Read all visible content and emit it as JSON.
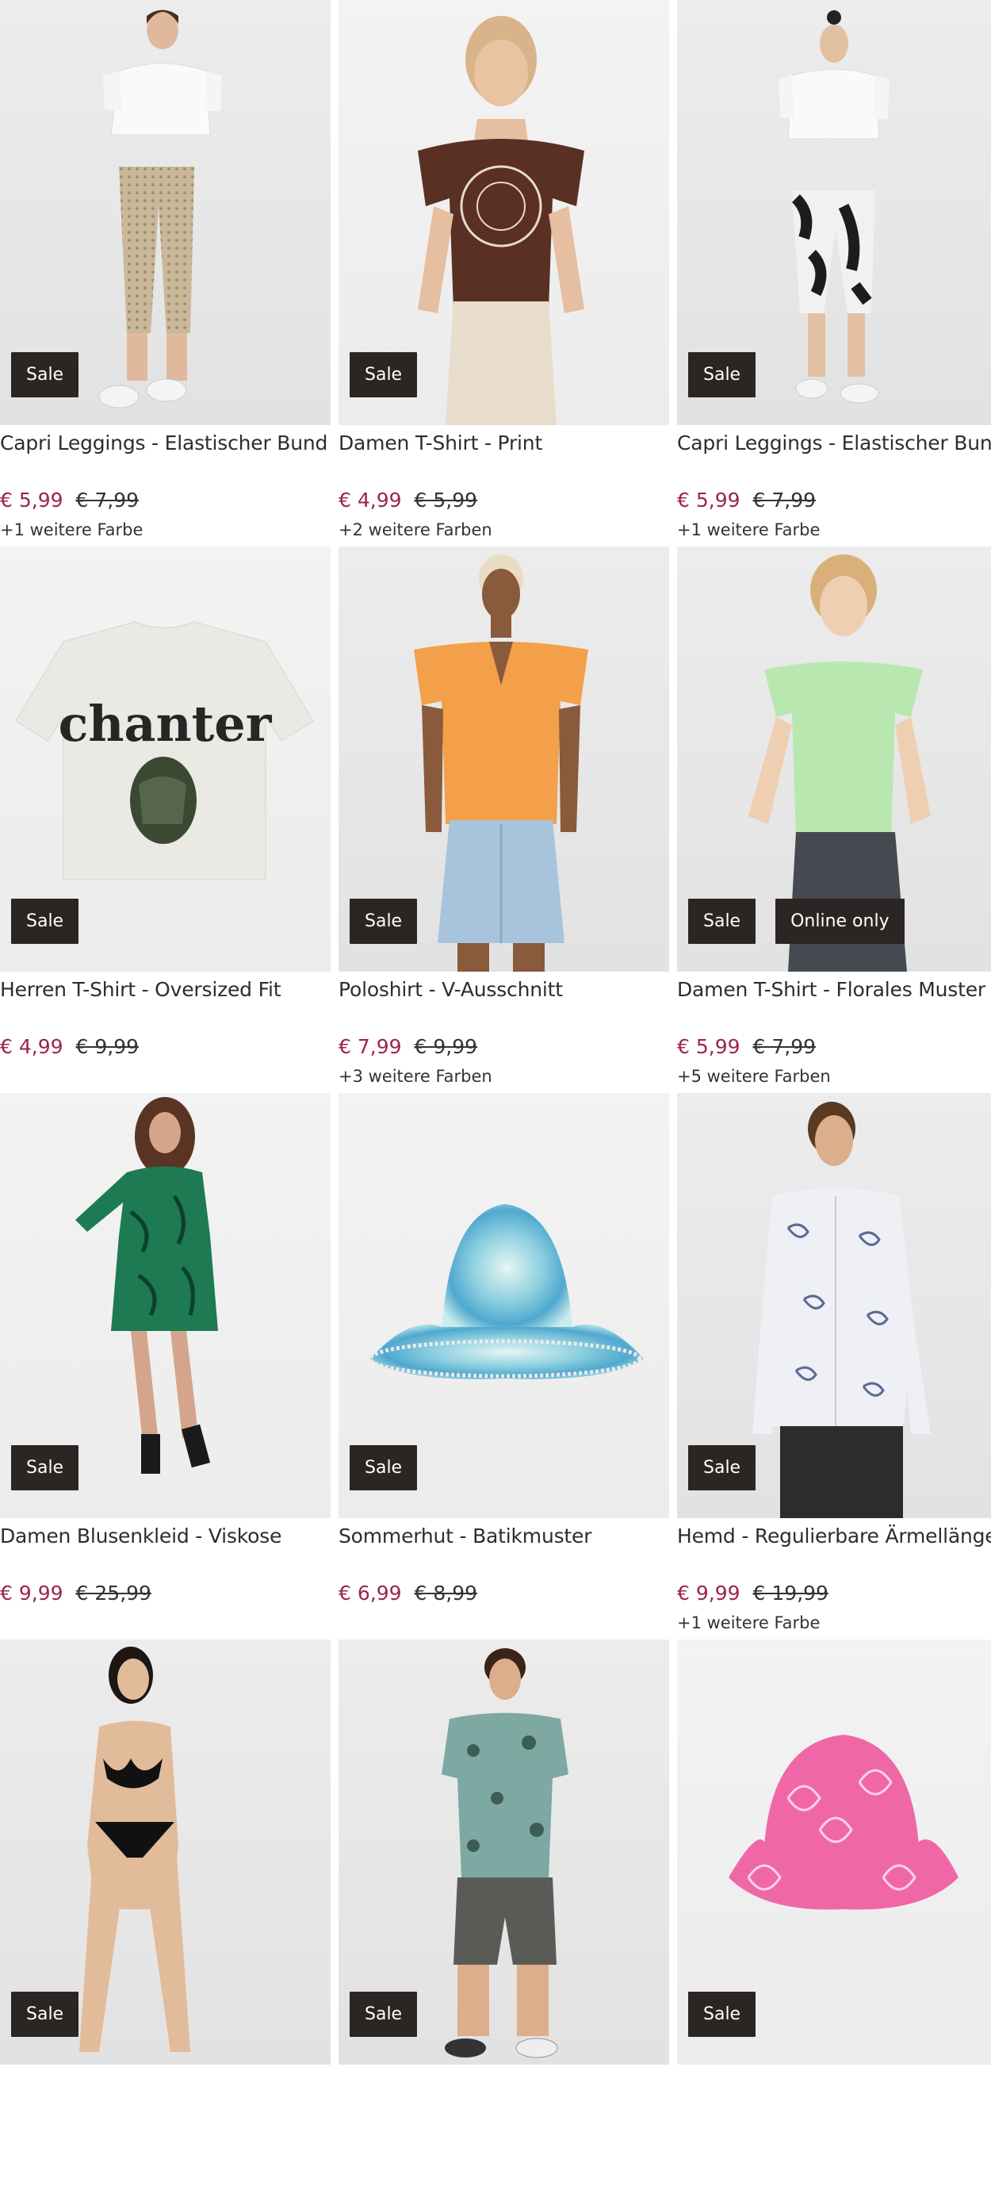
{
  "products": [
    {
      "title": "Capri Leggings - Elastischer Bund",
      "price": "€ 5,99",
      "old_price": "€ 7,99",
      "colors": "+1 weitere Farbe",
      "badges": [
        "Sale"
      ],
      "image": "woman-white-tee-leopard-capri"
    },
    {
      "title": "Damen T-Shirt - Print",
      "price": "€ 4,99",
      "old_price": "€ 5,99",
      "colors": "+2 weitere Farben",
      "badges": [
        "Sale"
      ],
      "image": "woman-brown-print-tee"
    },
    {
      "title": "Capri Leggings - Elastischer Bund",
      "price": "€ 5,99",
      "old_price": "€ 7,99",
      "colors": "+1 weitere Farbe",
      "badges": [
        "Sale"
      ],
      "image": "woman-white-tee-floral-capri"
    },
    {
      "title": "Herren T-Shirt - Oversized Fit",
      "price": "€ 4,99",
      "old_price": "€ 9,99",
      "colors": "",
      "badges": [
        "Sale"
      ],
      "image": "white-tee-chanter-print"
    },
    {
      "title": "Poloshirt - V-Ausschnitt",
      "price": "€ 7,99",
      "old_price": "€ 9,99",
      "colors": "+3 weitere Farben",
      "badges": [
        "Sale"
      ],
      "image": "woman-orange-polo"
    },
    {
      "title": "Damen T-Shirt - Florales Muster",
      "price": "€ 5,99",
      "old_price": "€ 7,99",
      "colors": "+5 weitere Farben",
      "badges": [
        "Sale",
        "Online only"
      ],
      "image": "woman-mint-tee"
    },
    {
      "title": "Damen Blusenkleid - Viskose",
      "price": "€ 9,99",
      "old_price": "€ 25,99",
      "colors": "",
      "badges": [
        "Sale"
      ],
      "image": "woman-green-dress"
    },
    {
      "title": "Sommerhut - Batikmuster",
      "price": "€ 6,99",
      "old_price": "€ 8,99",
      "colors": "",
      "badges": [
        "Sale"
      ],
      "image": "tie-dye-bucket-hat"
    },
    {
      "title": "Hemd - Regulierbare Ärmellänge",
      "price": "€ 9,99",
      "old_price": "€ 19,99",
      "colors": "+1 weitere Farbe",
      "badges": [
        "Sale"
      ],
      "image": "man-floral-shirt"
    },
    {
      "title": "",
      "price": "",
      "old_price": "",
      "colors": "",
      "badges": [
        "Sale"
      ],
      "image": "woman-black-bikini"
    },
    {
      "title": "",
      "price": "",
      "old_price": "",
      "colors": "",
      "badges": [
        "Sale"
      ],
      "image": "man-printed-tee-shorts"
    },
    {
      "title": "",
      "price": "",
      "old_price": "",
      "colors": "",
      "badges": [
        "Sale"
      ],
      "image": "pink-floral-bucket-hat"
    }
  ],
  "colors": {
    "price_now": "#9c2453",
    "badge_bg": "#2b2523"
  }
}
